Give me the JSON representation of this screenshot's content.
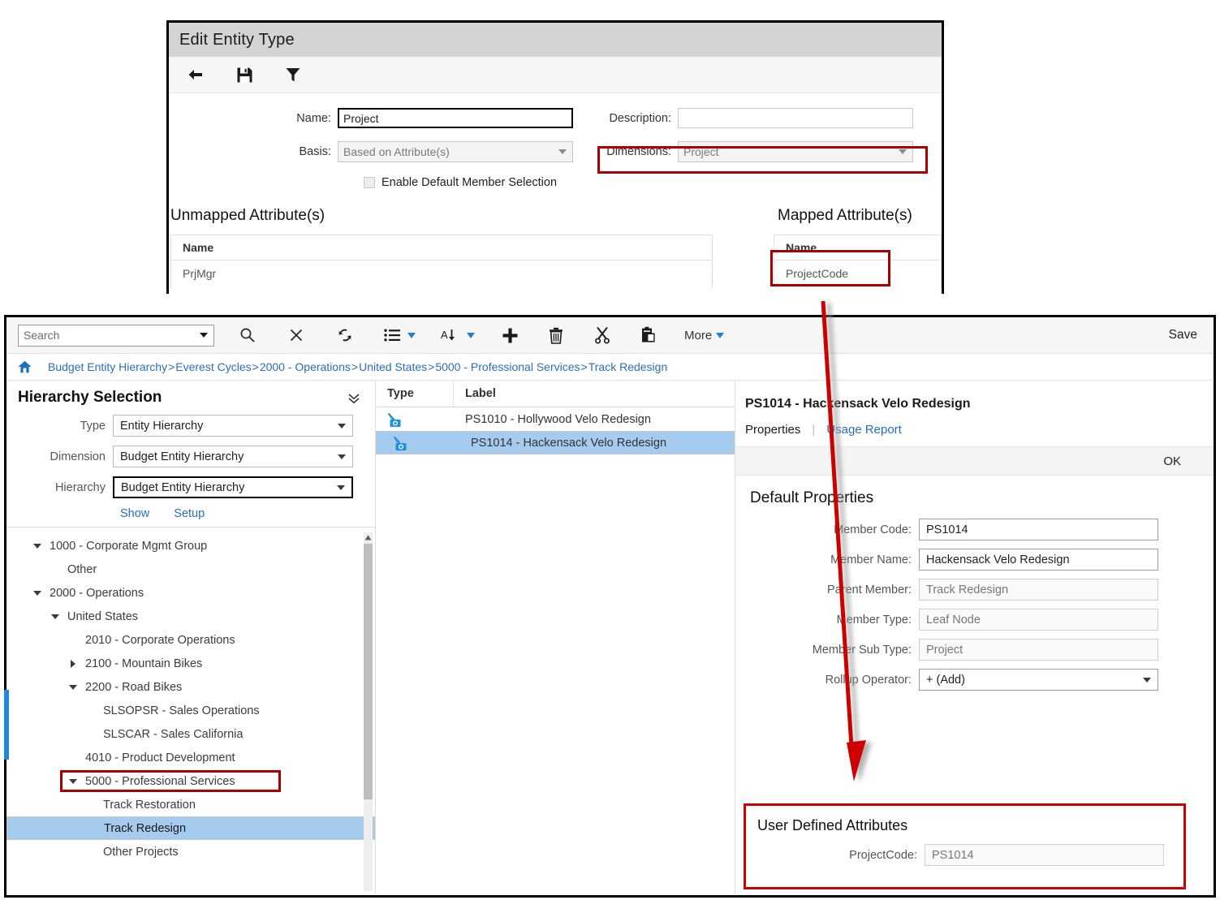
{
  "edit_entity_type": {
    "window_title": "Edit Entity Type",
    "toolbar": [
      {
        "name": "back-icon",
        "label": "Back"
      },
      {
        "name": "save-icon",
        "label": "Save"
      },
      {
        "name": "filter-icon",
        "label": "Filter"
      }
    ],
    "fields": {
      "name_label": "Name:",
      "name_value": "Project",
      "description_label": "Description:",
      "description_value": "",
      "basis_label": "Basis:",
      "basis_value": "Based on Attribute(s)",
      "dimensions_label": "Dimensions:",
      "dimensions_value": "Project",
      "enable_default_member_selection_label": "Enable Default Member Selection",
      "enable_default_member_selection_checked": false
    },
    "unmapped": {
      "heading": "Unmapped Attribute(s)",
      "column": "Name",
      "rows": [
        "PrjMgr"
      ]
    },
    "mapped": {
      "heading": "Mapped Attribute(s)",
      "column": "Name",
      "rows": [
        "ProjectCode"
      ]
    }
  },
  "app": {
    "toolbar": {
      "search_placeholder": "Search",
      "search_value": "",
      "icons": [
        {
          "name": "search-icon"
        },
        {
          "name": "clear-x-icon"
        },
        {
          "name": "refresh-icon"
        },
        {
          "name": "list-view-icon"
        },
        {
          "name": "sort-az-icon"
        },
        {
          "name": "add-plus-icon"
        },
        {
          "name": "delete-trash-icon"
        },
        {
          "name": "cut-scissors-icon"
        },
        {
          "name": "paste-clipboard-icon"
        }
      ],
      "more_label": "More",
      "save_label": "Save"
    },
    "breadcrumb": {
      "home_icon": "home-icon",
      "separator": ">",
      "items": [
        "Budget Entity Hierarchy",
        "Everest Cycles",
        "2000 - Operations",
        "United States",
        "5000 - Professional Services",
        "Track Redesign"
      ]
    },
    "hierarchy_selection": {
      "title": "Hierarchy Selection",
      "collapse_icon": "chevron-double-down-icon",
      "type_label": "Type",
      "type_value": "Entity Hierarchy",
      "dimension_label": "Dimension",
      "dimension_value": "Budget Entity Hierarchy",
      "hierarchy_label": "Hierarchy",
      "hierarchy_value": "Budget Entity Hierarchy",
      "show_link": "Show",
      "setup_link": "Setup"
    },
    "tree": [
      {
        "label": "1000 - Corporate Mgmt Group",
        "depth": 1,
        "toggle": "down",
        "selected": false,
        "highlighted": false
      },
      {
        "label": "Other",
        "depth": 2,
        "toggle": "none",
        "selected": false,
        "highlighted": false
      },
      {
        "label": "2000 - Operations",
        "depth": 1,
        "toggle": "down",
        "selected": false,
        "highlighted": false
      },
      {
        "label": "United States",
        "depth": 2,
        "toggle": "down",
        "selected": false,
        "highlighted": false
      },
      {
        "label": "2010 - Corporate Operations",
        "depth": 3,
        "toggle": "none",
        "selected": false,
        "highlighted": false
      },
      {
        "label": "2100 - Mountain Bikes",
        "depth": 3,
        "toggle": "right",
        "selected": false,
        "highlighted": false
      },
      {
        "label": "2200 - Road Bikes",
        "depth": 3,
        "toggle": "down",
        "selected": false,
        "highlighted": false
      },
      {
        "label": "SLSOPSR - Sales Operations",
        "depth": 4,
        "toggle": "none",
        "selected": false,
        "highlighted": false
      },
      {
        "label": "SLSCAR - Sales California",
        "depth": 4,
        "toggle": "none",
        "selected": false,
        "highlighted": false
      },
      {
        "label": "4010 - Product Development",
        "depth": 3,
        "toggle": "none",
        "selected": false,
        "highlighted": false
      },
      {
        "label": "5000 - Professional Services",
        "depth": 3,
        "toggle": "down",
        "selected": false,
        "highlighted": true
      },
      {
        "label": "Track Restoration",
        "depth": 4,
        "toggle": "none",
        "selected": false,
        "highlighted": false
      },
      {
        "label": "Track Redesign",
        "depth": 4,
        "toggle": "none",
        "selected": true,
        "highlighted": false
      },
      {
        "label": "Other Projects",
        "depth": 4,
        "toggle": "none",
        "selected": false,
        "highlighted": false
      }
    ],
    "grid": {
      "columns": [
        "Type",
        "Label"
      ],
      "rows": [
        {
          "type_icon": "member-add-icon",
          "label": "PS1010 - Hollywood Velo Redesign",
          "selected": false
        },
        {
          "type_icon": "member-add-icon",
          "label": "PS1014 - Hackensack Velo Redesign",
          "selected": true
        }
      ]
    },
    "properties_panel": {
      "title": "PS1014 - Hackensack Velo Redesign",
      "tab_properties": "Properties",
      "tab_usage_report": "Usage Report",
      "ok_label": "OK",
      "default_properties_heading": "Default Properties",
      "fields": [
        {
          "label": "Member Code:",
          "value": "PS1014",
          "readonly": false,
          "dropdown": false
        },
        {
          "label": "Member Name:",
          "value": "Hackensack Velo Redesign",
          "readonly": false,
          "dropdown": false
        },
        {
          "label": "Parent Member:",
          "value": "Track Redesign",
          "readonly": true,
          "dropdown": false
        },
        {
          "label": "Member Type:",
          "value": "Leaf Node",
          "readonly": true,
          "dropdown": false
        },
        {
          "label": "Member Sub Type:",
          "value": "Project",
          "readonly": true,
          "dropdown": false
        },
        {
          "label": "Rollup Operator:",
          "value": "+ (Add)",
          "readonly": false,
          "dropdown": true
        }
      ],
      "user_defined_attributes": {
        "heading": "User Defined Attributes",
        "fields": [
          {
            "label": "ProjectCode:",
            "value": "PS1014",
            "readonly": true
          }
        ]
      }
    }
  },
  "annotation": {
    "arrow_color": "#cc0000",
    "highlight_color": "#aa0000"
  }
}
